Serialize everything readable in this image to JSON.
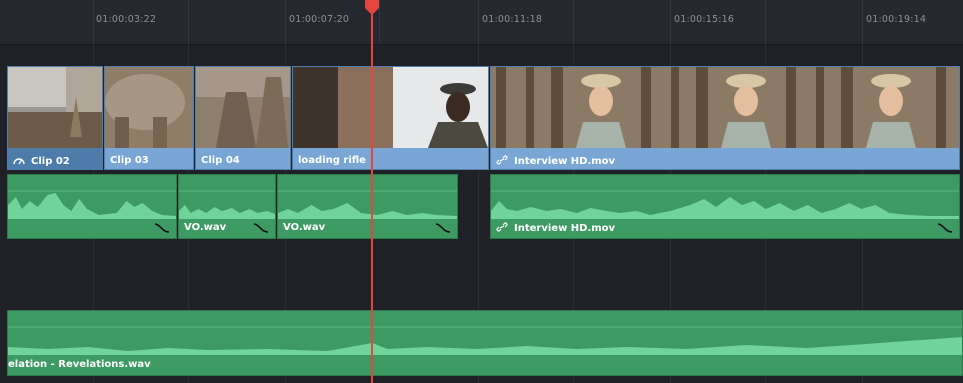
{
  "ruler": {
    "timecodes": [
      "01:00:03:22",
      "01:00:07:20",
      "01:00:11:18",
      "01:00:15:16",
      "01:00:19:14"
    ]
  },
  "video_track": {
    "clips": [
      {
        "label": "Clip 02",
        "icon": "speed-gauge-icon"
      },
      {
        "label": "Clip 03"
      },
      {
        "label": "Clip 04"
      },
      {
        "label": "loading rifle"
      },
      {
        "label": "Interview HD.mov",
        "icon": "link-icon"
      }
    ]
  },
  "audio_track_1": {
    "clips": [
      {
        "label": ""
      },
      {
        "label": "VO.wav"
      },
      {
        "label": "VO.wav"
      },
      {
        "label": "Interview HD.mov",
        "icon": "link-icon"
      }
    ]
  },
  "audio_track_2": {
    "clips": [
      {
        "label": "elation - Revelations.wav"
      }
    ]
  },
  "colors": {
    "video_clip": "#7aa6d6",
    "audio_clip": "#3e9a63",
    "playhead": "#e6453d",
    "background": "#1f2126"
  }
}
